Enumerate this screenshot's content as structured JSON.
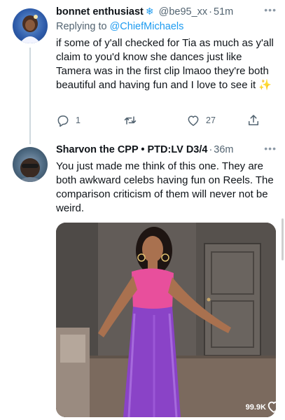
{
  "tweet1": {
    "name": "bonnet enthusiast",
    "handle": "@be95_xx",
    "time": "51m",
    "replying_prefix": "Replying to ",
    "replying_to": "@ChiefMichaels",
    "text": "if some of y'all checked for Tia as much as y'all claim to you'd know she dances just like Tamera was in the first clip lmaoo they're both beautiful and having fun and I love to see it ✨",
    "reply_count": "1",
    "retweet_count": "",
    "like_count": "27"
  },
  "tweet2": {
    "name": "Sharvon the CPP • PTD:LV D3/4",
    "time": "36m",
    "text": "You just made me think of this one. They are both awkward celebs having fun on Reels. The comparison criticism of them will never not be weird.",
    "media_views": "99.9K"
  },
  "icons": {
    "verified": "snowflake-icon",
    "reply": "reply-icon",
    "retweet": "retweet-icon",
    "like": "heart-icon",
    "share": "share-icon",
    "more": "more-icon"
  },
  "colors": {
    "accent": "#1d9bf0",
    "secondary_text": "#536471",
    "thread_line": "#cfd9de"
  }
}
